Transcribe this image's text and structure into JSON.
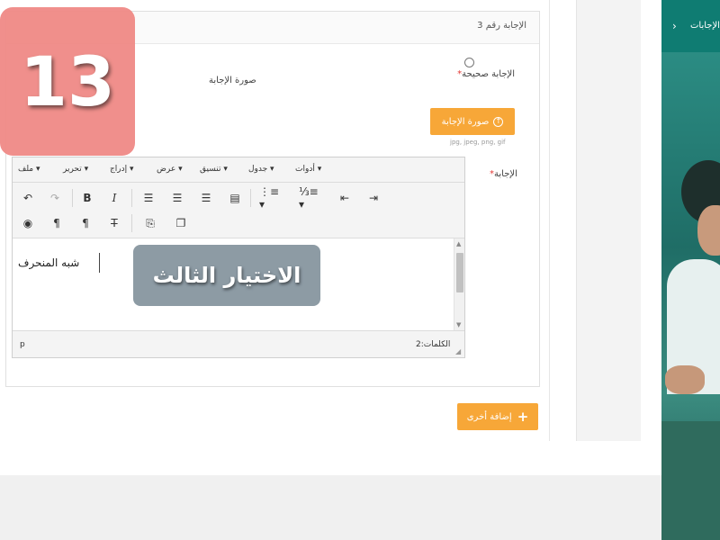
{
  "form": {
    "panel_title": "الإجابة رقم 3",
    "correct_answer_label": "الإجابة صحيحة",
    "required_mark": "*",
    "answer_image_label": "صورة الإجابة",
    "upload_button_label": "صورة الإجابة",
    "upload_hint": "jpg, jpeg, png, gif",
    "answer_label": "الإجابة",
    "add_another_label": "إضافة أخرى"
  },
  "editor": {
    "menu": [
      "ملف",
      "تحرير",
      "إدراج",
      "عرض",
      "تنسيق",
      "جدول",
      "أدوات"
    ],
    "content": "شبه المنحرف",
    "status_path": "p",
    "word_count": "الكلمات:2"
  },
  "sidebar": {
    "label": "الإجابات"
  },
  "overlay": {
    "step_number": "13",
    "caption": "الاختيار الثالث",
    "badge_color": "#f08a86",
    "caption_color": "#8796a0"
  },
  "colors": {
    "accent": "#f7a738",
    "sidebar": "#14655e"
  }
}
